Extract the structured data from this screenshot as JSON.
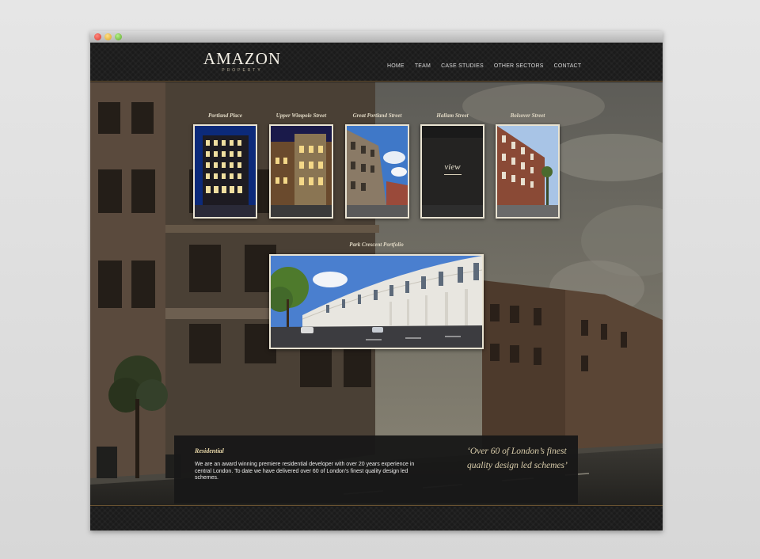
{
  "brand": {
    "name": "AMAZON",
    "tagline": "PROPERTY"
  },
  "nav": [
    "HOME",
    "TEAM",
    "CASE STUDIES",
    "OTHER SECTORS",
    "CONTACT"
  ],
  "properties": [
    {
      "label": "Portland Place"
    },
    {
      "label": "Upper Wimpole Street"
    },
    {
      "label": "Great Portland Street"
    },
    {
      "label": "Hallam Street",
      "overlay": "view"
    },
    {
      "label": "Bolsover Street"
    }
  ],
  "portfolio": {
    "label": "Park Crescent Portfolio"
  },
  "info": {
    "heading": "Residential",
    "text": "We are an award winning premiere residential developer with over 20 years experience in central London. To date we have delivered over 60 of London's finest quality design led schemes.",
    "quote": "‘Over 60 of London’s finest quality design led schemes’"
  },
  "colors": {
    "accent": "#e8d7a8",
    "header_bg": "#1b1b1b",
    "border_gold": "#6a5231"
  }
}
